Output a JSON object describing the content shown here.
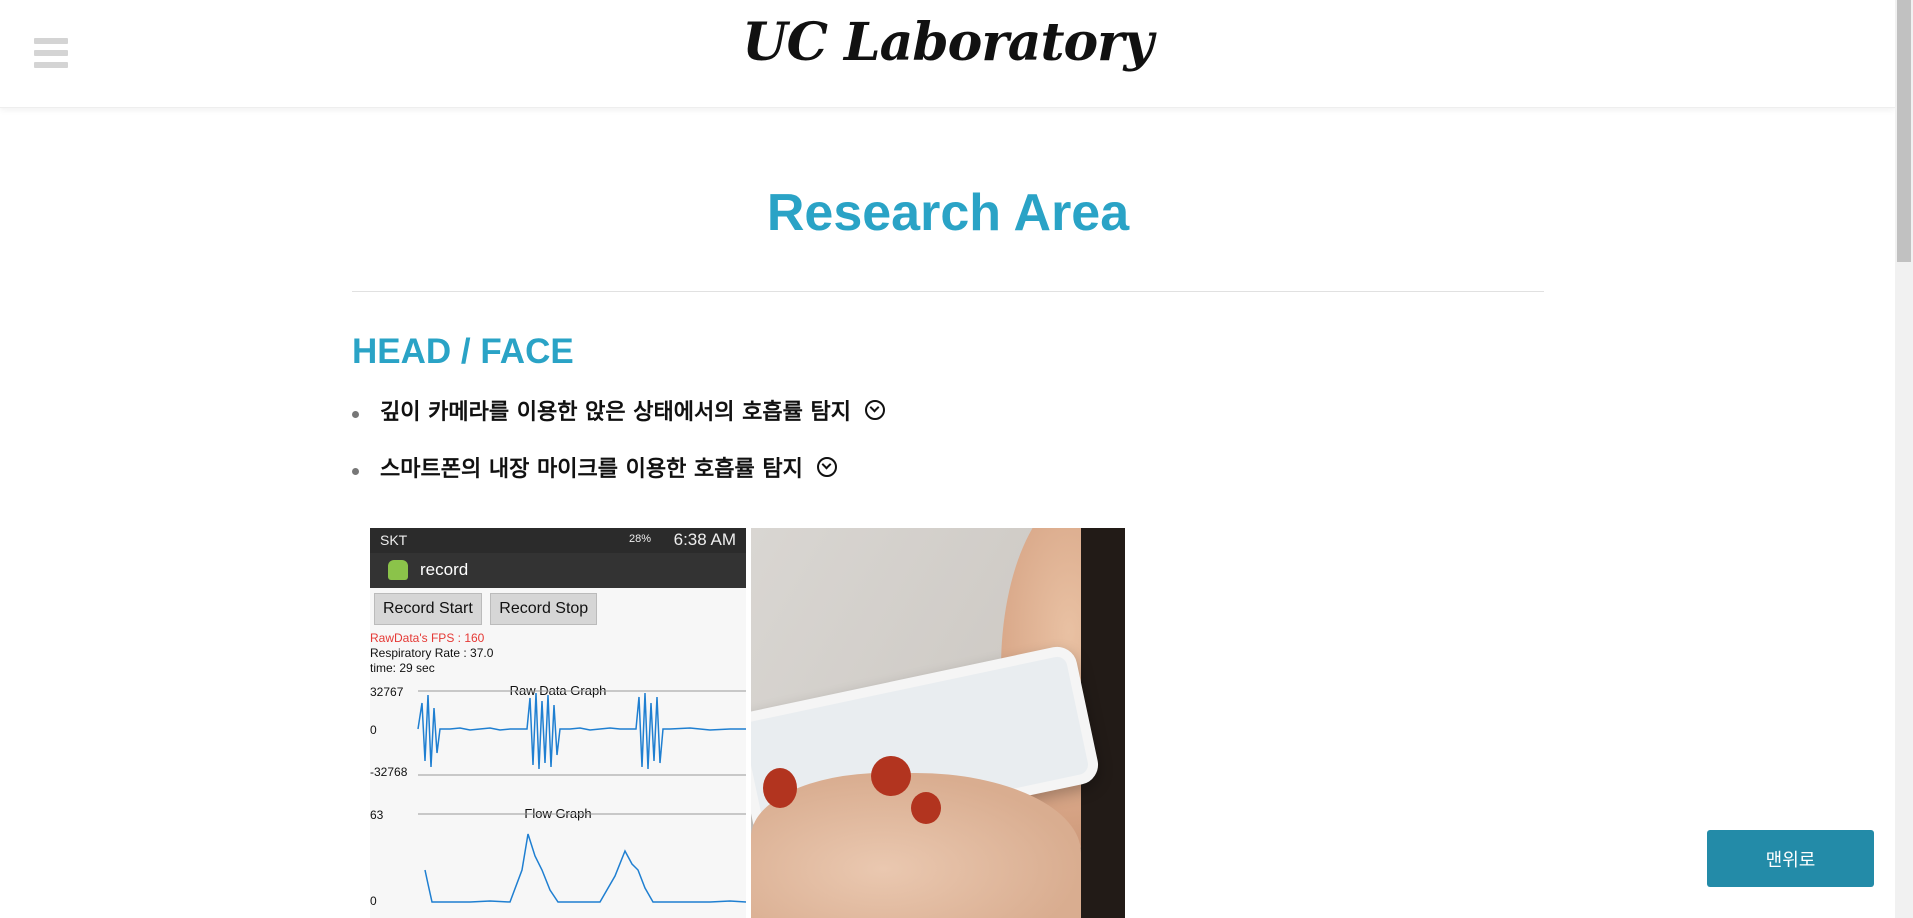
{
  "header": {
    "logo": "UC Laboratory",
    "menu_icon": "hamburger-icon"
  },
  "main": {
    "title": "Research Area",
    "section_title": "HEAD / FACE",
    "items": [
      {
        "label": "깊이 카메라를 이용한 앉은 상태에서의 호흡률 탐지",
        "icon": "chevron-circle-down-icon"
      },
      {
        "label": "스마트폰의 내장 마이크를 이용한 호흡률 탐지",
        "icon": "chevron-circle-down-icon"
      }
    ]
  },
  "phone_screenshot": {
    "carrier": "SKT",
    "battery": "28%",
    "time": "6:38 AM",
    "app_name": "record",
    "buttons": [
      "Record Start",
      "Record Stop"
    ],
    "fps_text": "RawData's FPS : 160",
    "rate_text": "Respiratory Rate : 37.0",
    "time_text": "time: 29 sec",
    "raw_graph": {
      "title": "Raw Data Graph",
      "ticks": [
        "32767",
        "0",
        "-32768"
      ]
    },
    "flow_graph": {
      "title": "Flow Graph",
      "ticks": [
        "63",
        "0"
      ]
    }
  },
  "to_top_label": "맨위로",
  "colors": {
    "accent": "#2aa3c6",
    "button": "#238ba8"
  }
}
